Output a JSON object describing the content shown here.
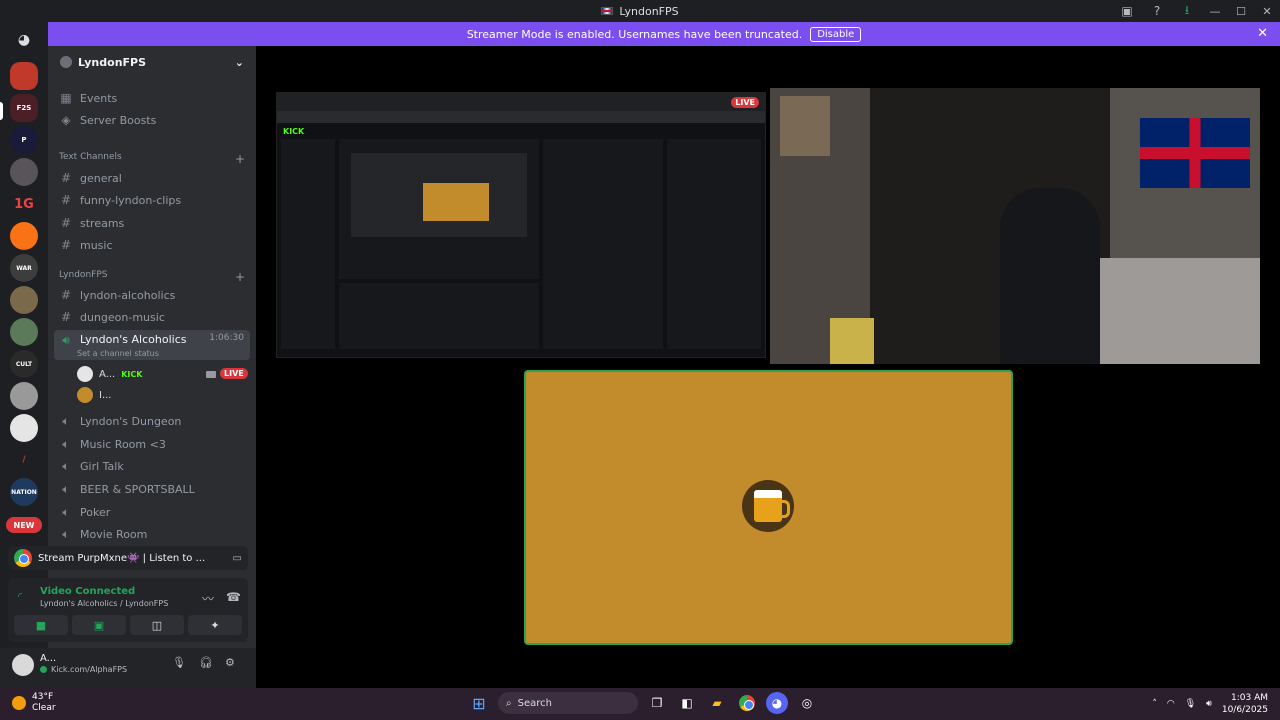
{
  "window": {
    "title": "LyndonFPS"
  },
  "banner": {
    "text": "Streamer Mode is enabled. Usernames have been truncated.",
    "disable_label": "Disable"
  },
  "guild_badge": {
    "new": "NEW"
  },
  "server": {
    "name": "LyndonFPS"
  },
  "top_links": [
    {
      "label": "Events"
    },
    {
      "label": "Server Boosts"
    }
  ],
  "categories": {
    "text": "Text Channels",
    "lyndon": "LyndonFPS"
  },
  "text_channels": [
    {
      "name": "general"
    },
    {
      "name": "funny-lyndon-clips"
    },
    {
      "name": "streams"
    },
    {
      "name": "music"
    }
  ],
  "lyndon_channels": [
    {
      "name": "lyndon-alcoholics"
    },
    {
      "name": "dungeon-music"
    }
  ],
  "voice_active": {
    "name": "Lyndon's Alcoholics",
    "time": "1:06:30",
    "status": "Set a channel status"
  },
  "voice_users": [
    {
      "name": "A...",
      "badge": "KICK",
      "live": "LIVE"
    },
    {
      "name": "I..."
    }
  ],
  "voice_channels": [
    {
      "name": "Lyndon's Dungeon"
    },
    {
      "name": "Music Room <3"
    },
    {
      "name": "Girl Talk"
    },
    {
      "name": "BEER & SPORTSBALL"
    },
    {
      "name": "Poker"
    },
    {
      "name": "Movie Room"
    }
  ],
  "activity": {
    "text": "Stream PurpMxne👾 | Listen to ..."
  },
  "voice_panel": {
    "status": "Video Connected",
    "location": "Lyndon's Alcoholics / LyndonFPS"
  },
  "user": {
    "name": "A...",
    "status": "Kick.com/AlphaFPS"
  },
  "stage": {
    "live_label": "LIVE"
  },
  "taskbar": {
    "temp": "43°F",
    "weather": "Clear",
    "search": "Search",
    "time": "1:03 AM",
    "date": "10/6/2025"
  },
  "colors": {
    "accent": "#7b4ef0",
    "connected": "#23a55a",
    "live": "#da373c",
    "tile": "#c28b2c"
  }
}
